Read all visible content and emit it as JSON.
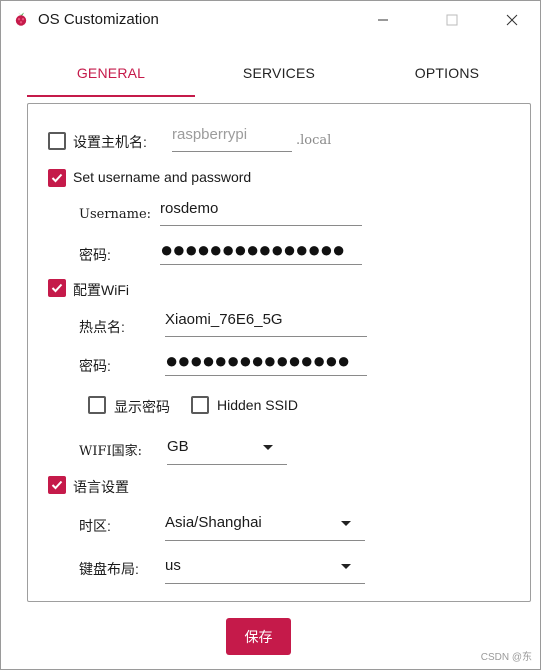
{
  "window": {
    "title": "OS Customization",
    "icon": "raspberry-pi-icon"
  },
  "tabs": [
    {
      "label": "GENERAL",
      "active": true
    },
    {
      "label": "SERVICES",
      "active": false
    },
    {
      "label": "OPTIONS",
      "active": false
    }
  ],
  "general": {
    "hostname": {
      "label": "设置主机名:",
      "checked": false,
      "placeholder": "raspberrypi",
      "suffix": ".local"
    },
    "user": {
      "label": "Set username and password",
      "checked": true,
      "username_label": "Username:",
      "username_value": "rosdemo",
      "password_label": "密码:",
      "password_value": "●●●●●●●●●●●●●●●"
    },
    "wifi": {
      "label": "配置WiFi",
      "checked": true,
      "ssid_label": "热点名:",
      "ssid_value": "Xiaomi_76E6_5G",
      "password_label": "密码:",
      "password_value": "●●●●●●●●●●●●●●●",
      "show_password_label": "显示密码",
      "show_password_checked": false,
      "hidden_ssid_label": "Hidden SSID",
      "hidden_ssid_checked": false,
      "country_label": "WIFI国家:",
      "country_value": "GB"
    },
    "locale": {
      "label": "语言设置",
      "checked": true,
      "timezone_label": "时区:",
      "timezone_value": "Asia/Shanghai",
      "keyboard_label": "键盘布局:",
      "keyboard_value": "us"
    }
  },
  "save_label": "保存",
  "watermark": "CSDN @东",
  "colors": {
    "accent": "#c51a4a"
  }
}
